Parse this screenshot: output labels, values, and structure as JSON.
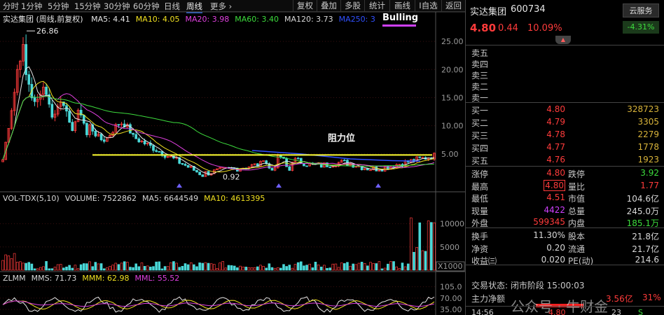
{
  "toolbar": {
    "timeframes": [
      "分时",
      "1分钟",
      "5分钟",
      "15分钟",
      "30分钟",
      "60分钟",
      "日线",
      "周线",
      "更多 ›"
    ],
    "active_timeframe": "周线",
    "tools": [
      "复权",
      "叠加",
      "多股",
      "统计",
      "画线",
      "I自选",
      "返回"
    ]
  },
  "main_chart": {
    "title": "实达集团 (周线,前复权)",
    "ma": [
      {
        "label": "MA5: 4.41",
        "color": "#e6e6e6"
      },
      {
        "label": "MA10: 4.05",
        "color": "#f0e020"
      },
      {
        "label": "MA20: 3.98",
        "color": "#e040e0"
      },
      {
        "label": "MA60: 3.40",
        "color": "#3ddc3d"
      },
      {
        "label": "MA120: 3.73",
        "color": "#d8d8d8"
      },
      {
        "label": "MA250: 3",
        "color": "#3050ff"
      }
    ],
    "bulling_label": "Bulling",
    "resistance_label": "阻力位",
    "high_label": "26.86",
    "low_label": "0.92",
    "y_ticks": [
      "25.00",
      "20.00",
      "15.00",
      "10.00",
      "5.00"
    ]
  },
  "volume": {
    "labels": [
      {
        "text": "VOL-TDX(5,10)",
        "color": "#d8d8d8"
      },
      {
        "text": "VOLUME: 7522862",
        "color": "#d8d8d8"
      },
      {
        "text": "MA5: 6644549",
        "color": "#d8d8d8"
      },
      {
        "text": "MA10: 4613395",
        "color": "#f0e020"
      }
    ],
    "y_ticks": [
      "10000",
      "5000"
    ],
    "unit": "X1000"
  },
  "zlmm": {
    "labels": [
      {
        "text": "ZLMM",
        "color": "#d8d8d8"
      },
      {
        "text": "MMS: 71.73",
        "color": "#d8d8d8"
      },
      {
        "text": "MMM: 62.98",
        "color": "#f0e020"
      },
      {
        "text": "MML: 55.52",
        "color": "#e040e0"
      }
    ],
    "y_ticks": [
      "105.0",
      "70.00",
      "35.00"
    ]
  },
  "quote": {
    "name": "实达集团",
    "code": "600734",
    "cloud_button": "云服务",
    "cloud_pct": "-4.31%",
    "price": "4.80",
    "change": "0.44",
    "change_pct": "10.09%",
    "asks": [
      {
        "label": "卖五",
        "price": "",
        "vol": ""
      },
      {
        "label": "卖四",
        "price": "",
        "vol": ""
      },
      {
        "label": "卖三",
        "price": "",
        "vol": ""
      },
      {
        "label": "卖二",
        "price": "",
        "vol": ""
      },
      {
        "label": "卖一",
        "price": "",
        "vol": ""
      }
    ],
    "bids": [
      {
        "label": "买一",
        "price": "4.80",
        "vol": "328723"
      },
      {
        "label": "买二",
        "price": "4.79",
        "vol": "3305"
      },
      {
        "label": "买三",
        "price": "4.78",
        "vol": "2279"
      },
      {
        "label": "买四",
        "price": "4.77",
        "vol": "1778"
      },
      {
        "label": "买五",
        "price": "4.76",
        "vol": "1923"
      }
    ],
    "stats_a": [
      {
        "l1": "涨停",
        "v1": "4.80",
        "c1": "red",
        "l2": "跌停",
        "v2": "3.92",
        "c2": "green"
      },
      {
        "l1": "最高",
        "v1": "4.80",
        "c1": "red boxed",
        "l2": "量比",
        "v2": "1.77",
        "c2": "red"
      },
      {
        "l1": "最低",
        "v1": "4.51",
        "c1": "red",
        "l2": "市值",
        "v2": "104.6亿",
        "c2": "white"
      },
      {
        "l1": "现量",
        "v1": "4422",
        "c1": "purple",
        "l2": "总量",
        "v2": "245.0万",
        "c2": "white"
      },
      {
        "l1": "外盘",
        "v1": "599345",
        "c1": "red",
        "l2": "内盘",
        "v2": "185.1万",
        "c2": "green"
      }
    ],
    "stats_b": [
      {
        "l1": "换手",
        "v1": "11.30%",
        "c1": "white",
        "l2": "股本",
        "v2": "21.8亿",
        "c2": "white"
      },
      {
        "l1": "净资",
        "v1": "0.20",
        "c1": "white",
        "l2": "流通",
        "v2": "21.7亿",
        "c2": "white"
      },
      {
        "l1": "收益㈢",
        "v1": "0.020",
        "c1": "white",
        "l2": "PE(动)",
        "v2": "214.6",
        "c2": "white"
      }
    ],
    "trade_status_label": "交易状态: 闭市阶段 15:00:03",
    "main_net_label": "主力净额",
    "main_net_value": "3.56亿",
    "main_net_pct": "31%",
    "tick_time": "14:56",
    "tick_price": "4.80",
    "tick_vol": "23",
    "tick_flag": "S",
    "watermark": "公众号 · 牛财金"
  }
}
